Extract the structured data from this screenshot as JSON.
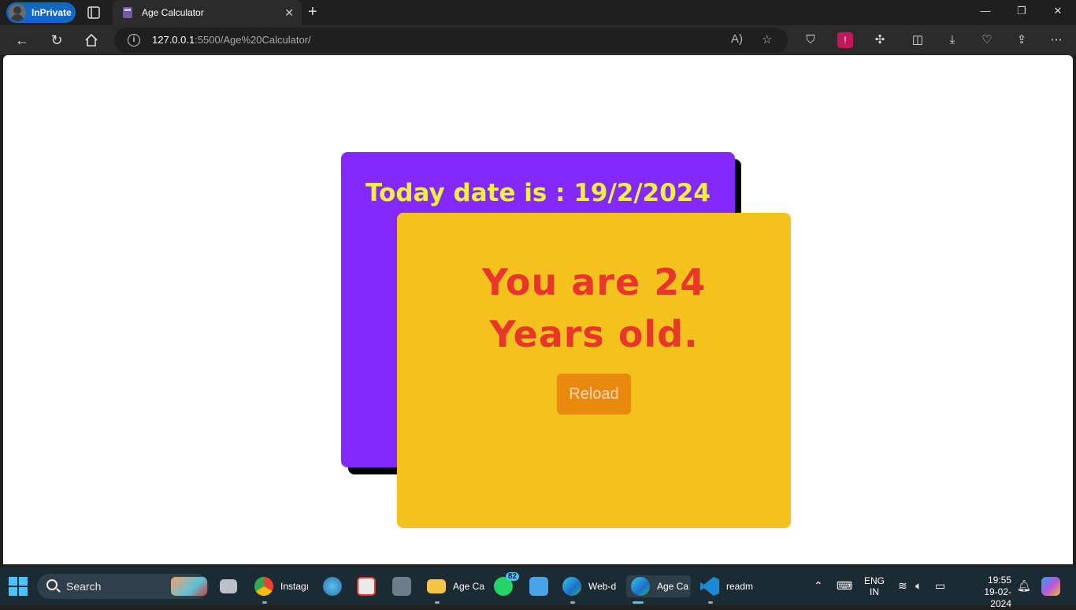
{
  "browser": {
    "inprivate_label": "InPrivate",
    "tab_title": "Age Calculator",
    "url_host": "127.0.0.1",
    "url_path": ":5500/Age%20Calculator/"
  },
  "page": {
    "today_text": "Today date is : 19/2/2024",
    "age_line1": "You are 24",
    "age_line2": "Years old.",
    "reload_label": "Reload"
  },
  "taskbar": {
    "search_label": "Search",
    "apps": [
      {
        "label": "Instagı"
      },
      {
        "label": "Age Ca"
      },
      {
        "label": "Web-d"
      },
      {
        "label": "Age Ca"
      },
      {
        "label": "readm"
      }
    ],
    "whatsapp_badge": "82",
    "lang_line1": "ENG",
    "lang_line2": "IN",
    "time": "19:55",
    "date": "19-02-2024"
  },
  "colors": {
    "card_back": "#8429fb",
    "card_front": "#f3c21f",
    "today_text": "#f0f042",
    "age_text": "#e8362b",
    "reload_bg": "#e78a0e"
  }
}
